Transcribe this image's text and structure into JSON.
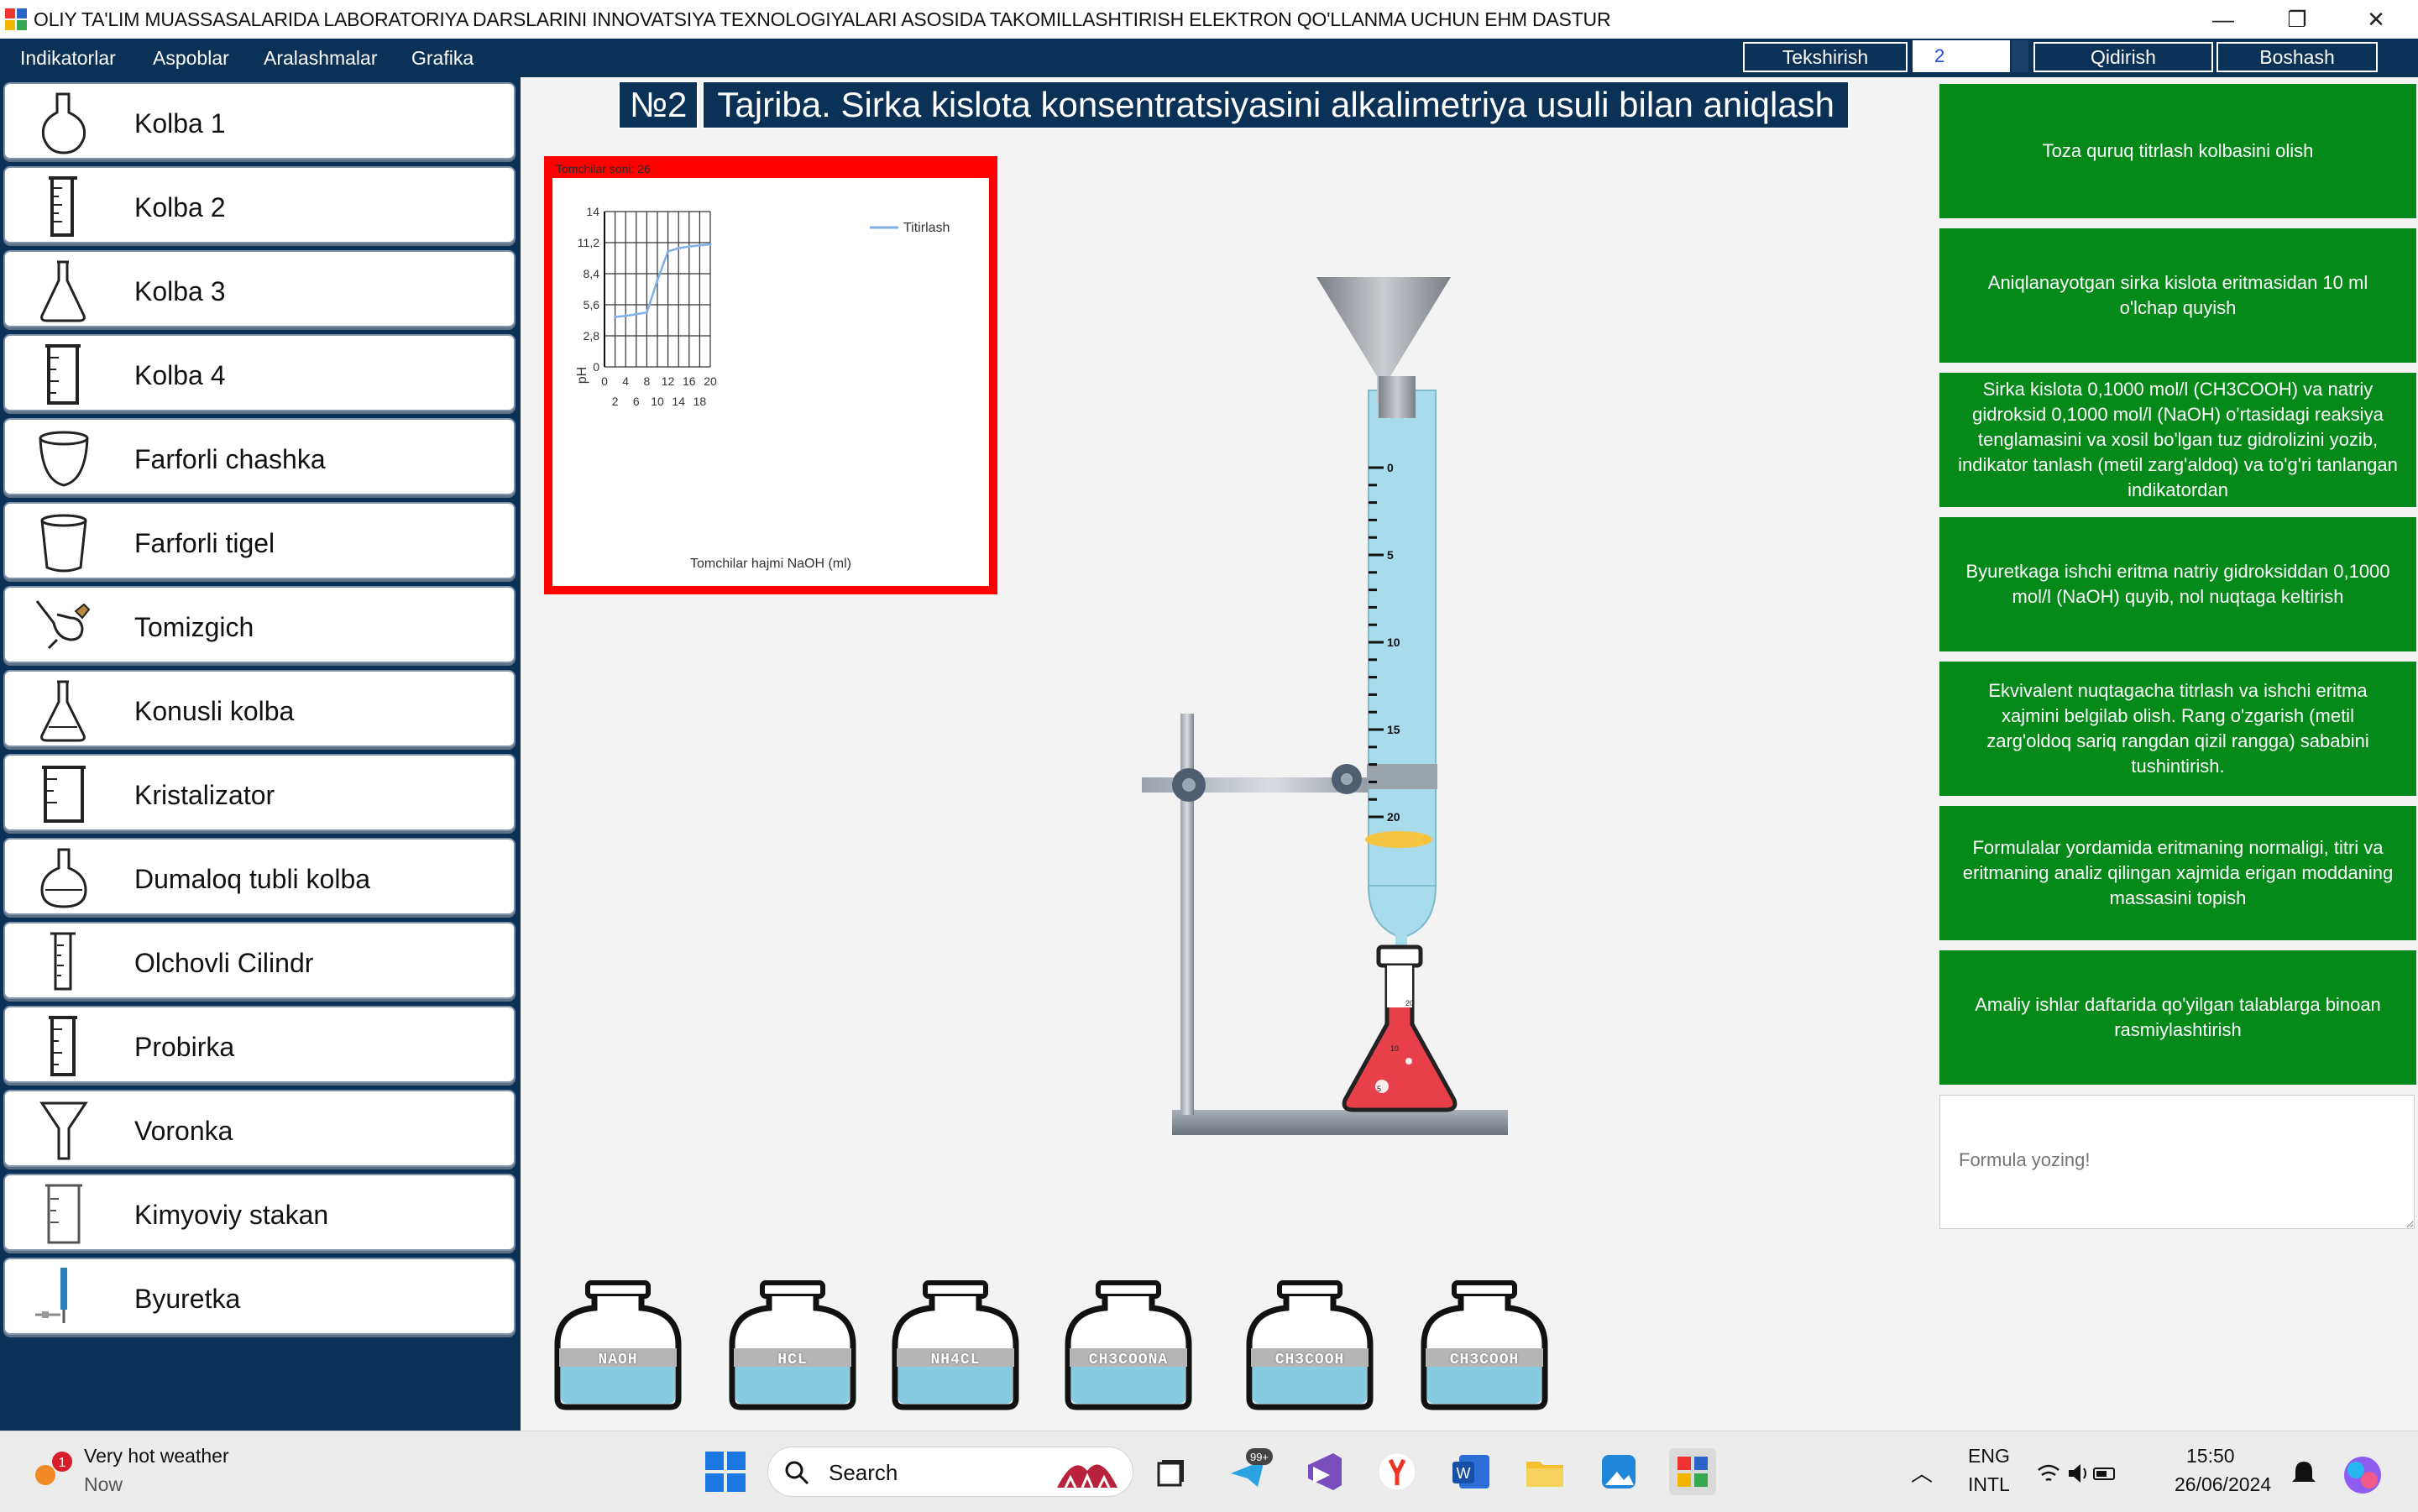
{
  "window": {
    "title": "OLIY TA'LIM  MUASSASALARIDA LABORATORIYA DARSLARINI INNOVATSIYA TEXNOLOGIYALARI ASOSIDA TAKOMILLASHTIRISH ELEKTRON QO'LLANMA UCHUN EHM DASTUR",
    "minimize": "—",
    "maximize": "❐",
    "close": "✕"
  },
  "menu": {
    "items": [
      "Indikatorlar",
      "Aspoblar",
      "Aralashmalar",
      "Grafika"
    ],
    "check_button": "Tekshirish",
    "spinner_value": "2",
    "search_button": "Qidirish",
    "home_button": "Boshash"
  },
  "sidebar": {
    "items": [
      {
        "label": "Kolba 1",
        "icon": "round-flask-icon"
      },
      {
        "label": "Kolba 2",
        "icon": "graduated-cylinder-icon"
      },
      {
        "label": "Kolba 3",
        "icon": "conical-flask-icon"
      },
      {
        "label": "Kolba 4",
        "icon": "beaker-icon"
      },
      {
        "label": "Farforli chashka",
        "icon": "porcelain-cup-icon"
      },
      {
        "label": "Farforli tigel",
        "icon": "crucible-icon"
      },
      {
        "label": "Tomizgich",
        "icon": "dropper-icon"
      },
      {
        "label": "Konusli kolba",
        "icon": "conical-flask-icon"
      },
      {
        "label": "Kristalizator",
        "icon": "crystallizer-icon"
      },
      {
        "label": "Dumaloq tubli kolba",
        "icon": "round-bottom-flask-icon"
      },
      {
        "label": "Olchovli Cilindr",
        "icon": "measuring-cylinder-icon"
      },
      {
        "label": "Probirka",
        "icon": "test-tube-icon"
      },
      {
        "label": "Voronka",
        "icon": "funnel-icon"
      },
      {
        "label": "Kimyoviy stakan",
        "icon": "chemical-beaker-icon"
      },
      {
        "label": "Byuretka",
        "icon": "burette-icon"
      }
    ]
  },
  "experiment": {
    "number": "№2",
    "title": "Tajriba.  Sirka kislota konsentratsiyasini alkalimetriya usuli bilan aniqlash"
  },
  "chart_caption": "Tomchilar soni: 26",
  "chart_data": {
    "type": "line",
    "title": "",
    "xlabel": "Tomchilar hajmi NaOH (ml)",
    "ylabel": "pH",
    "xlim": [
      0,
      20
    ],
    "ylim": [
      0,
      14
    ],
    "x_ticks_top": [
      "0",
      "4",
      "8",
      "12",
      "16",
      "20"
    ],
    "x_ticks_bottom": [
      "2",
      "6",
      "10",
      "14",
      "18"
    ],
    "y_ticks": [
      "0",
      "2,8",
      "5,6",
      "8,4",
      "11,2",
      "14"
    ],
    "legend_position": "top-right",
    "grid": true,
    "series": [
      {
        "name": "Titirlash",
        "color": "#7fb0e8",
        "x": [
          2,
          4,
          6,
          8,
          10,
          12,
          14,
          16,
          18,
          20
        ],
        "y": [
          4.5,
          4.6,
          4.75,
          4.9,
          7.8,
          10.4,
          10.7,
          10.85,
          10.95,
          11.05
        ]
      }
    ]
  },
  "burette": {
    "scale_labels": [
      "0",
      "5",
      "10",
      "15",
      "20"
    ]
  },
  "flask": {
    "mark_labels": [
      "20",
      "10",
      "5"
    ]
  },
  "reagents": {
    "bottles": [
      "NaOH",
      "HCl",
      "NH4Cl",
      "CH3COONa",
      "CH3COOH",
      "CH3COOH"
    ]
  },
  "steps": [
    "Toza quruq titrlash kolbasini olish",
    "Aniqlanayotgan sirka kislota eritmasidan 10 ml o'lchap quyish",
    "Sirka kislota 0,1000 mol/l (CH3COOH) va natriy gidroksid 0,1000 mol/l (NaOH) o'rtasidagi reaksiya tenglamasini  va xosil bo'lgan tuz gidrolizini yozib, indikator tanlash (metil zarg'aldoq) va to'g'ri tanlangan indikatordan",
    "Byuretkaga ishchi eritma natriy gidroksiddan 0,1000 mol/l (NaOH) quyib, nol nuqtaga keltirish",
    "Ekvivalent nuqtagacha titrlash va ishchi eritma xajmini belgilab olish. Rang o'zgarish (metil zarg'oldoq sariq rangdan qizil rangga) sababini tushintirish.",
    "Formulalar yordamida eritmaning normaligi, titri va eritmaning analiz qilingan xajmida erigan moddaning massasini topish",
    "Amaliy ishlar daftarida qo'yilgan talablarga binoan rasmiylashtirish"
  ],
  "formula": {
    "placeholder": "Formula yozing!"
  },
  "taskbar": {
    "weather_title": "Very hot weather",
    "weather_sub": "Now",
    "weather_badge": "1",
    "search": "Search",
    "telegram_badge": "99+",
    "lang_top": "ENG",
    "lang_bottom": "INTL",
    "time": "15:50",
    "date": "26/06/2024"
  },
  "colors": {
    "navy": "#0b3157",
    "step_green": "#058a1a",
    "chart_border": "#ff0000",
    "liquid_blue": "#a8dced",
    "flask_red": "#e8404a"
  }
}
